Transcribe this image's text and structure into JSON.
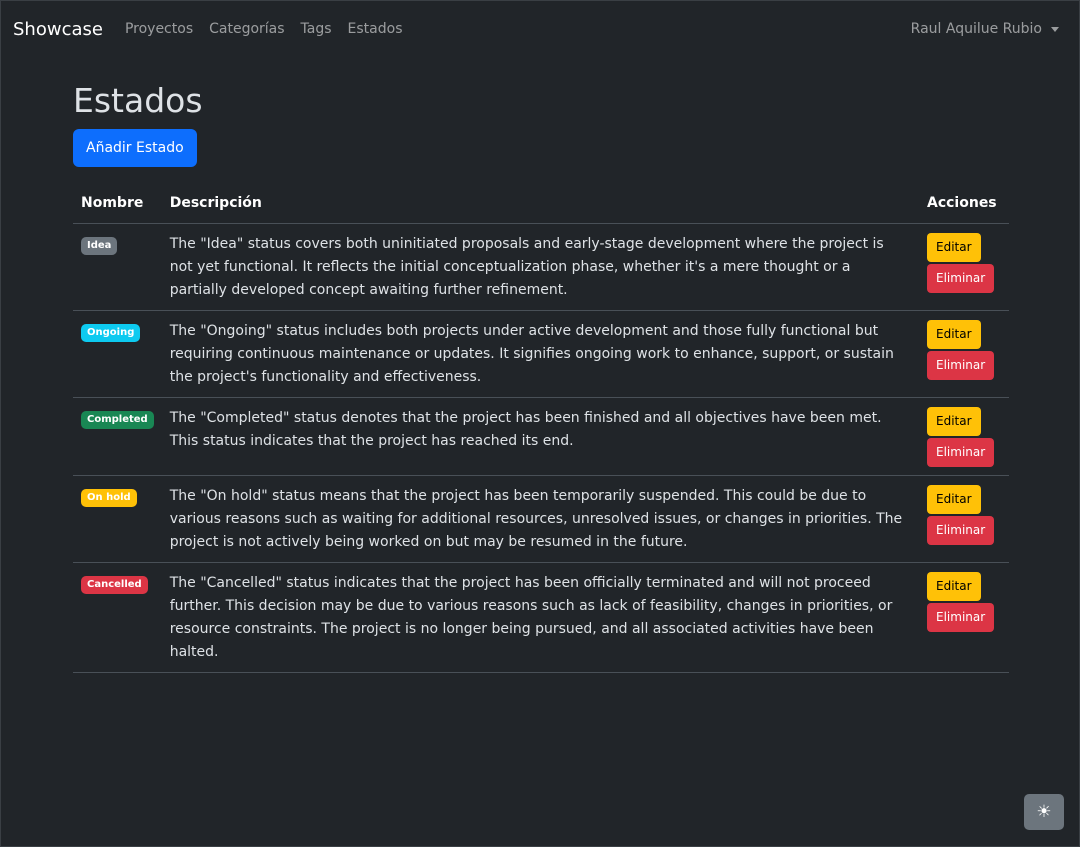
{
  "navbar": {
    "brand": "Showcase",
    "links": [
      "Proyectos",
      "Categorías",
      "Tags",
      "Estados"
    ],
    "user": "Raul Aquilue Rubio"
  },
  "page": {
    "title": "Estados",
    "add_button": "Añadir Estado"
  },
  "table": {
    "headers": {
      "name": "Nombre",
      "description": "Descripción",
      "actions": "Acciones"
    },
    "edit_label": "Editar",
    "delete_label": "Eliminar",
    "rows": [
      {
        "name": "Idea",
        "badge_color": "#6c757d",
        "description": "The \"Idea\" status covers both uninitiated proposals and early-stage development where the project is not yet functional. It reflects the initial conceptualization phase, whether it's a mere thought or a partially developed concept awaiting further refinement."
      },
      {
        "name": "Ongoing",
        "badge_color": "#0dcaf0",
        "description": "The \"Ongoing\" status includes both projects under active development and those fully functional but requiring continuous maintenance or updates. It signifies ongoing work to enhance, support, or sustain the project's functionality and effectiveness."
      },
      {
        "name": "Completed",
        "badge_color": "#198754",
        "description": "The \"Completed\" status denotes that the project has been finished and all objectives have been met. This status indicates that the project has reached its end."
      },
      {
        "name": "On hold",
        "badge_color": "#ffc107",
        "description": "The \"On hold\" status means that the project has been temporarily suspended. This could be due to various reasons such as waiting for additional resources, unresolved issues, or changes in priorities. The project is not actively being worked on but may be resumed in the future."
      },
      {
        "name": "Cancelled",
        "badge_color": "#dc3545",
        "description": "The \"Cancelled\" status indicates that the project has been officially terminated and will not proceed further. This decision may be due to various reasons such as lack of feasibility, changes in priorities, or resource constraints. The project is no longer being pursued, and all associated activities have been halted."
      }
    ]
  },
  "theme_toggle": {
    "icon": "sun-icon",
    "glyph": "☀"
  }
}
